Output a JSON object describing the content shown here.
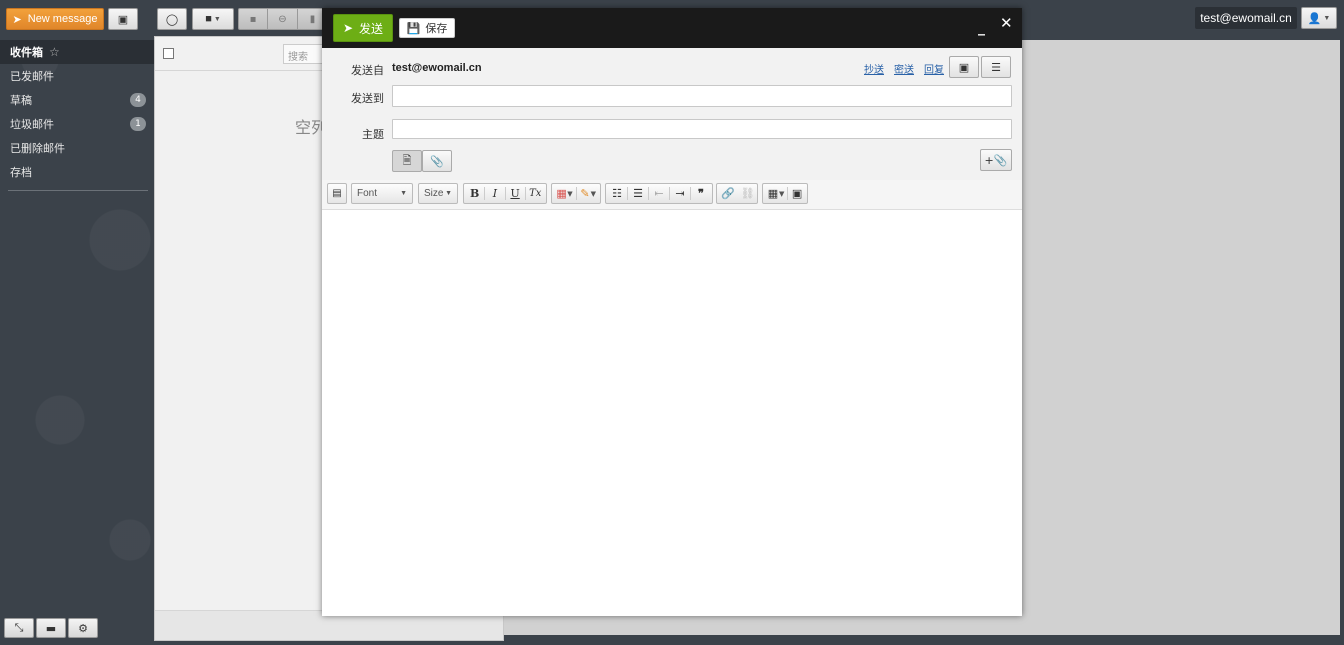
{
  "topbar": {
    "new_message_label": "New message",
    "user_email": "test@ewomail.cn"
  },
  "sidebar": {
    "folders": [
      {
        "label": "收件箱",
        "active": true
      },
      {
        "label": "已发邮件"
      },
      {
        "label": "草稿",
        "count": "4"
      },
      {
        "label": "垃圾邮件",
        "count": "1"
      },
      {
        "label": "已删除邮件"
      },
      {
        "label": "存档"
      }
    ]
  },
  "list": {
    "search_placeholder": "搜索",
    "empty_text": "空列"
  },
  "compose": {
    "send_label": "发送",
    "save_label": "保存",
    "from_label": "发送自",
    "from_value": "test@ewomail.cn",
    "to_label": "发送到",
    "subject_label": "主题",
    "links": {
      "cc": "抄送",
      "bcc": "密送",
      "reply": "回复"
    },
    "toolbar": {
      "font_label": "Font",
      "size_label": "Size",
      "bold": "B",
      "italic": "I",
      "underline": "U",
      "clear_format": "Tx"
    }
  },
  "colors": {
    "send_green": "#6dae15",
    "new_message_orange": "#e8922f",
    "sidebar_bg": "#3b424a",
    "compose_header": "#1a1a1a"
  }
}
